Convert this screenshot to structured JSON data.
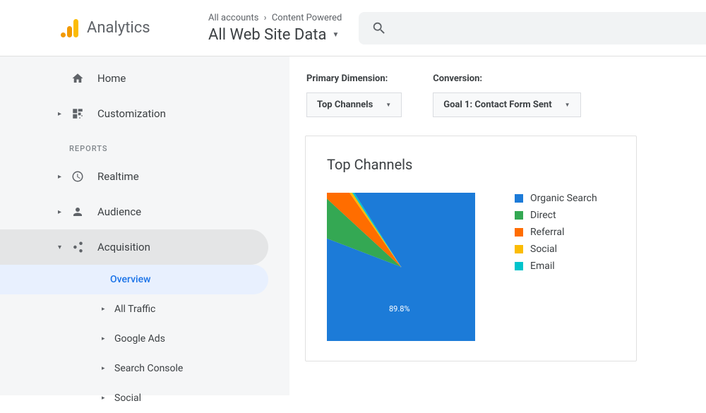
{
  "header": {
    "product": "Analytics",
    "breadcrumb_all": "All accounts",
    "breadcrumb_account": "Content Powered",
    "view": "All Web Site Data"
  },
  "sidebar": {
    "home": "Home",
    "customization": "Customization",
    "reports_label": "REPORTS",
    "realtime": "Realtime",
    "audience": "Audience",
    "acquisition": "Acquisition",
    "sub": {
      "overview": "Overview",
      "all_traffic": "All Traffic",
      "google_ads": "Google Ads",
      "search_console": "Search Console",
      "social": "Social"
    }
  },
  "filters": {
    "primary_label": "Primary Dimension:",
    "primary_value": "Top Channels",
    "conversion_label": "Conversion:",
    "conversion_value": "Goal 1: Contact Form Sent"
  },
  "card": {
    "title": "Top Channels"
  },
  "chart_data": {
    "type": "pie",
    "title": "Top Channels",
    "series": [
      {
        "name": "Organic Search",
        "value": 89.8,
        "color": "#1c7bd8"
      },
      {
        "name": "Direct",
        "value": 6.0,
        "color": "#34a853"
      },
      {
        "name": "Referral",
        "value": 3.5,
        "color": "#ff6d00"
      },
      {
        "name": "Social",
        "value": 0.4,
        "color": "#fbbc04"
      },
      {
        "name": "Email",
        "value": 0.3,
        "color": "#00c4cc"
      }
    ],
    "center_label": "89.8%"
  }
}
